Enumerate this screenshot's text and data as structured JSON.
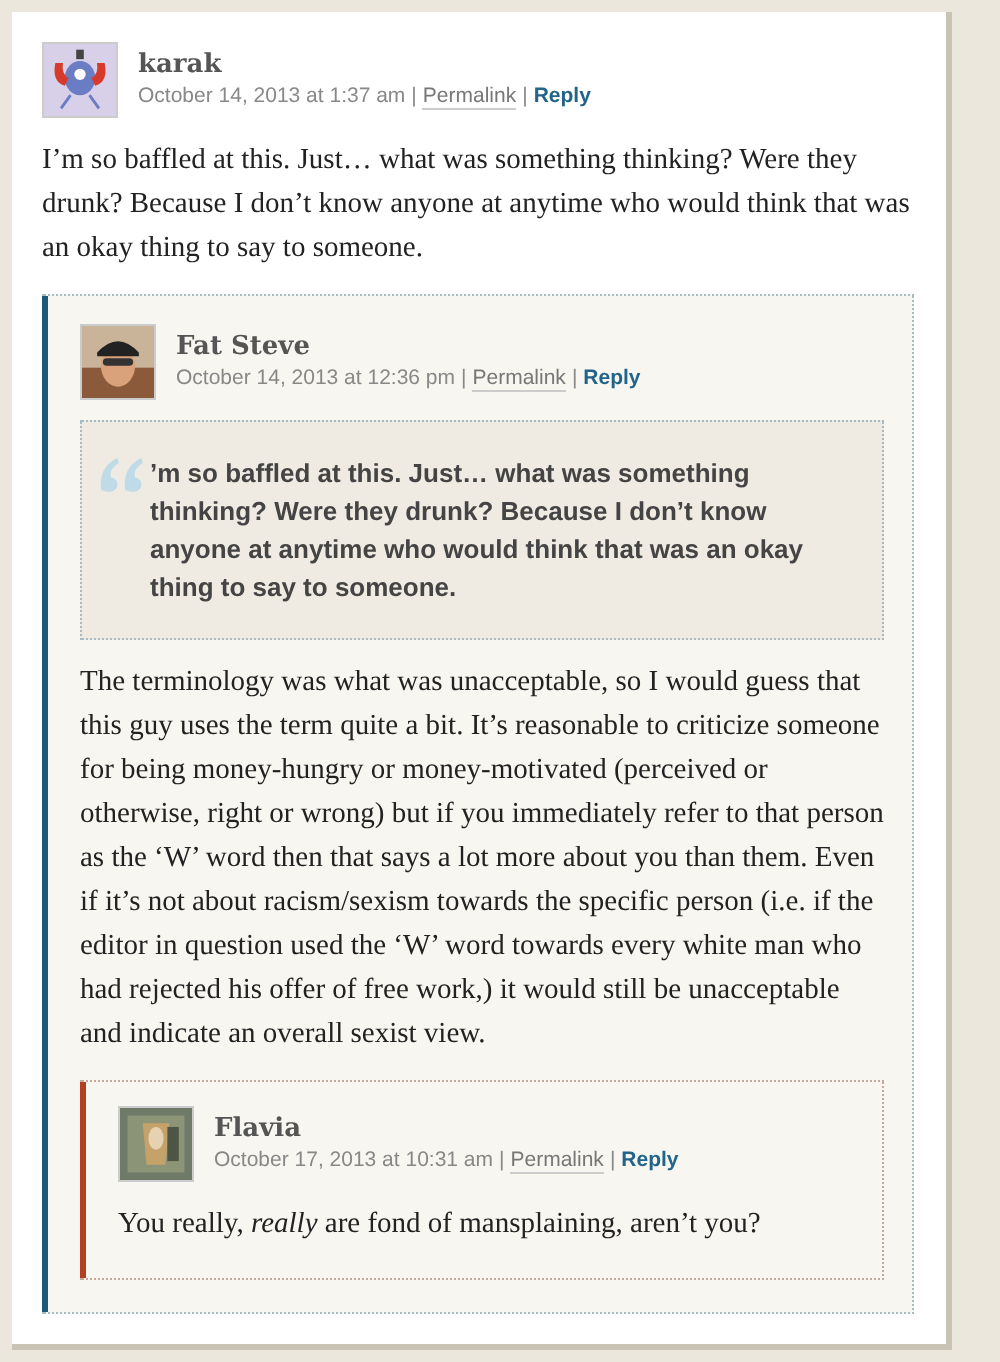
{
  "comments": [
    {
      "author": "karak",
      "meta": [
        {
          "kind": "date",
          "text": "October 14, 2013 at 1:37 am"
        },
        {
          "kind": "separator",
          "text": "|"
        },
        {
          "kind": "permalink",
          "text": "Permalink"
        },
        {
          "kind": "separator",
          "text": "|"
        },
        {
          "kind": "reply",
          "text": "Reply"
        }
      ],
      "body": "I’m so baffled at this. Just… what was something thinking? Were they drunk? Because I don’t know anyone at anytime who would think that was an okay thing to say to someone.",
      "replies": [
        {
          "author": "Fat Steve",
          "color": "#1d5a7a",
          "meta": [
            {
              "kind": "date",
              "text": "October 14, 2013 at 12:36 pm"
            },
            {
              "kind": "separator",
              "text": "|"
            },
            {
              "kind": "permalink",
              "text": "Permalink"
            },
            {
              "kind": "separator",
              "text": "|"
            },
            {
              "kind": "reply",
              "text": "Reply"
            }
          ],
          "quote": "’m so baffled at this. Just… what was something thinking? Were they drunk? Because I don’t know anyone at anytime who would think that was an okay thing to say to someone.",
          "body": "The terminology was what was unacceptable, so I would guess that this guy uses the term quite a bit. It’s reasonable to criticize someone for being money-hungry or money-motivated (perceived or otherwise, right or wrong) but if you immediately refer to that person as the ‘W’ word then that says a lot more about you than them. Even if it’s not about racism/sexism towards the specific person (i.e. if the editor in question used the ‘W’ word towards every white man who had rejected his offer of free work,) it would still be unacceptable and indicate an overall sexist view.",
          "replies": [
            {
              "author": "Flavia",
              "color": "#b5401f",
              "meta": [
                {
                  "kind": "date",
                  "text": "October 17, 2013 at 10:31 am"
                },
                {
                  "kind": "separator",
                  "text": "|"
                },
                {
                  "kind": "permalink",
                  "text": "Permalink"
                },
                {
                  "kind": "separator",
                  "text": "|"
                },
                {
                  "kind": "reply",
                  "text": "Reply"
                }
              ],
              "body": "You really, *really* are fond of mansplaining, aren’t you?"
            }
          ]
        }
      ]
    }
  ]
}
